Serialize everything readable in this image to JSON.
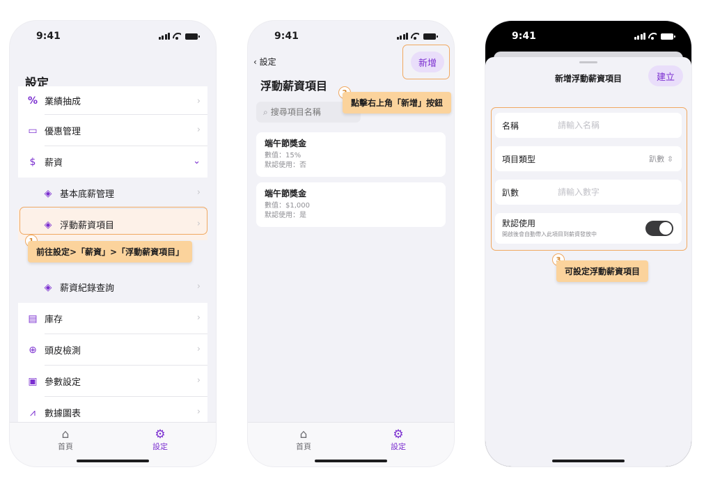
{
  "status": {
    "time": "9:41"
  },
  "settings_screen": {
    "title": "設定",
    "items": [
      {
        "label": "業績抽成",
        "icon": "percent-icon"
      },
      {
        "label": "優惠管理",
        "icon": "ticket-icon"
      },
      {
        "label": "薪資",
        "icon": "salary-icon",
        "expanded": true
      },
      {
        "label": "基本底薪管理",
        "icon": "diamond-icon",
        "sub": true
      },
      {
        "label": "浮動薪資項目",
        "icon": "diamond-icon",
        "sub": true,
        "active": true
      },
      {
        "label": "薪資紀錄查詢",
        "icon": "diamond-icon",
        "sub": true
      },
      {
        "label": "庫存",
        "icon": "archive-icon"
      },
      {
        "label": "頭皮檢測",
        "icon": "magnifier-icon"
      },
      {
        "label": "參數設定",
        "icon": "params-icon"
      },
      {
        "label": "數據圖表",
        "icon": "chart-icon"
      }
    ],
    "tip1": "前往設定>「薪資」>「浮動薪資項目」",
    "badge1": "1"
  },
  "tabs": {
    "home": "首頁",
    "settings": "設定"
  },
  "list_screen": {
    "back": "設定",
    "add": "新增",
    "title": "浮動薪資項目",
    "search_placeholder": "搜尋項目名稱",
    "tip2": "點擊右上角「新增」按鈕",
    "badge2": "2",
    "cards": [
      {
        "title": "端午節獎金",
        "value": "數值：15%",
        "default": "默認使用：否"
      },
      {
        "title": "端午節獎金",
        "value": "數值：$1,000",
        "default": "默認使用：是"
      }
    ]
  },
  "create_screen": {
    "title": "新增浮動薪資項目",
    "create": "建立",
    "name_label": "名稱",
    "name_placeholder": "請輸入名稱",
    "type_label": "項目類型",
    "type_value": "趴數",
    "amount_label": "趴數",
    "amount_placeholder": "請輸入數字",
    "default_label": "默認使用",
    "default_hint": "開啟後會自動帶入此項目到薪資發放中",
    "default_on": true,
    "tip3": "可設定浮動薪資項目",
    "badge3": "3"
  },
  "colors": {
    "accent": "#7b2fd0",
    "highlight": "#f0a860",
    "tip": "#fbd39c"
  }
}
